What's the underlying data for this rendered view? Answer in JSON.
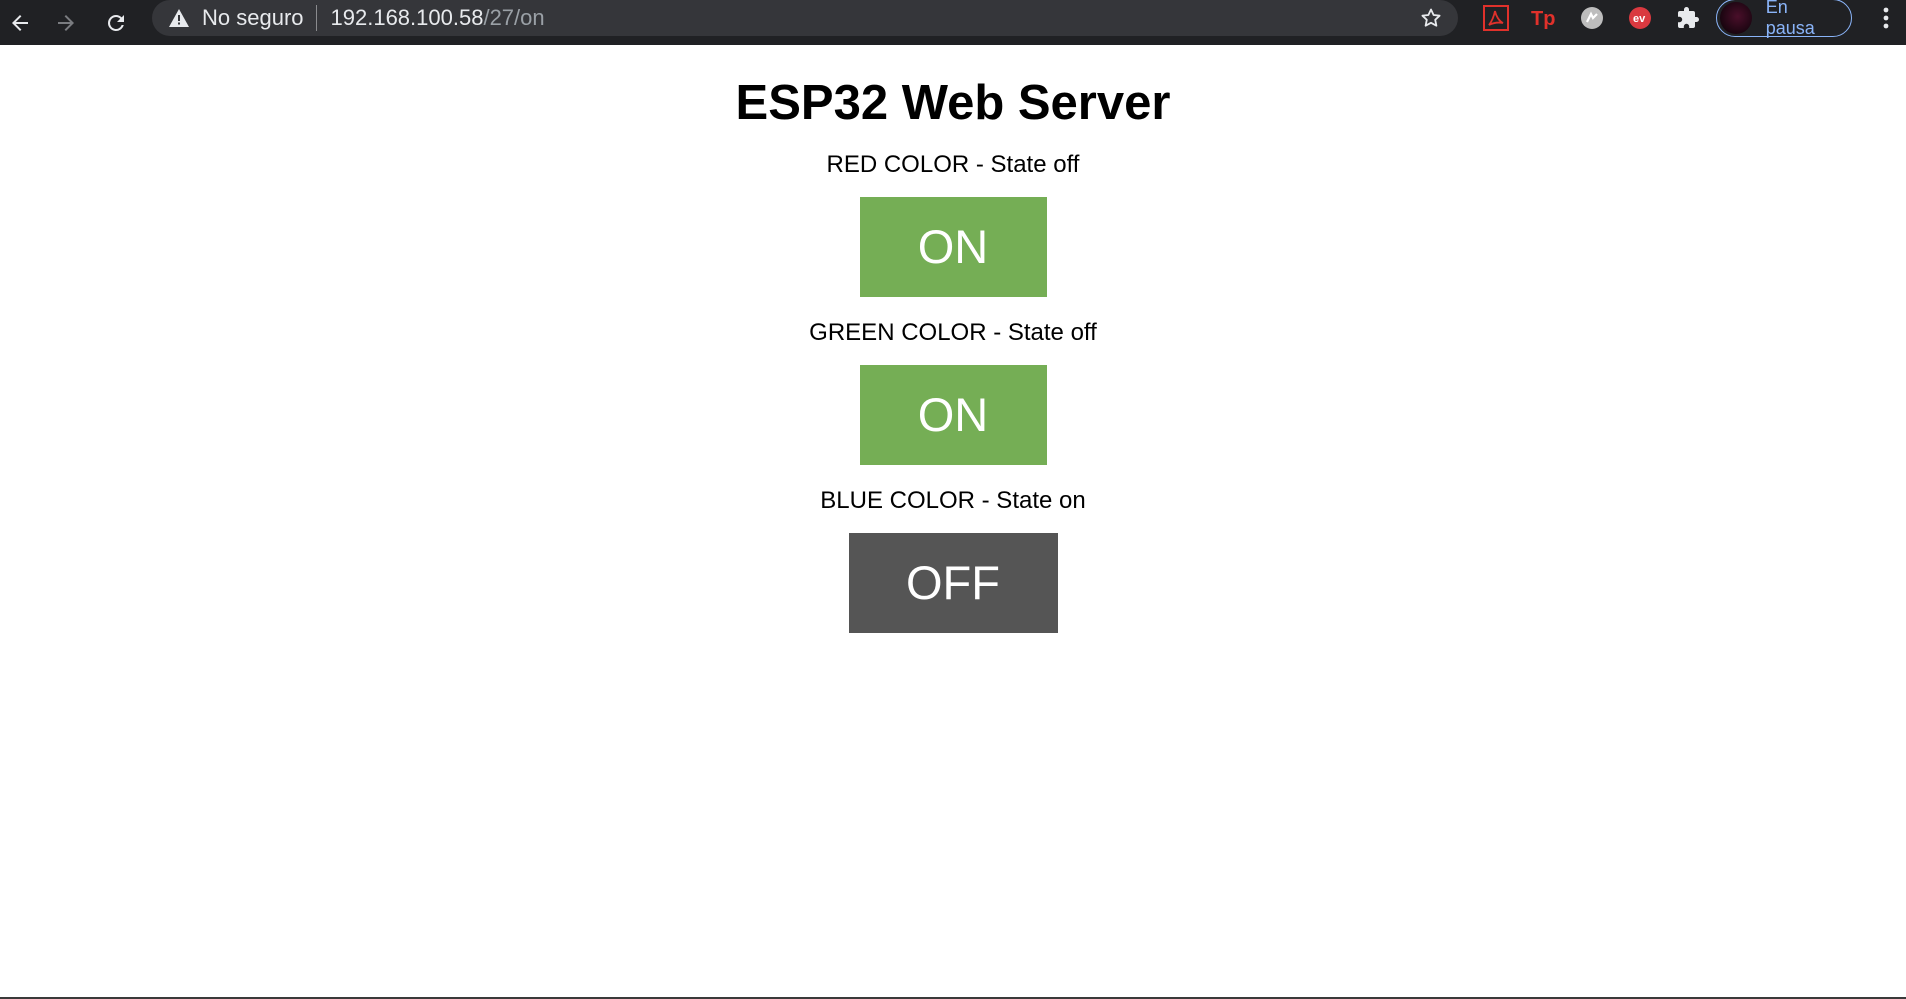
{
  "browser": {
    "security_label": "No seguro",
    "url_host": "192.168.100.58",
    "url_path": "/27/on",
    "profile_label": "En pausa",
    "icons": [
      "back-arrow-icon",
      "forward-arrow-icon",
      "reload-icon",
      "warning-icon",
      "star-icon",
      "adobe-pdf-extension-icon",
      "tp-extension-icon",
      "circle-extension-icon",
      "expressvpn-extension-icon",
      "puzzle-extensions-icon",
      "kebab-menu-icon"
    ],
    "colors": {
      "toolbar_bg": "#202124",
      "omnibox_bg": "#35363a",
      "profile_accent": "#8ab4f8"
    }
  },
  "page": {
    "title": "ESP32 Web Server",
    "controls": [
      {
        "label": "RED COLOR - State off",
        "button": "ON"
      },
      {
        "label": "GREEN COLOR - State off",
        "button": "ON"
      },
      {
        "label": "BLUE COLOR - State on",
        "button": "OFF"
      }
    ],
    "colors": {
      "on_button": "#75ae55",
      "off_button": "#555555"
    }
  }
}
